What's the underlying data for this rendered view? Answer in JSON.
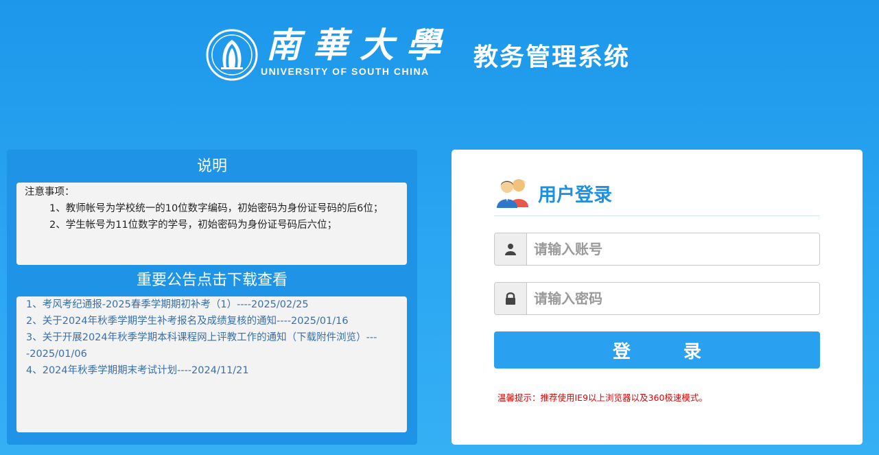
{
  "header": {
    "school_name_cn": "南華大學",
    "school_name_en": "UNIVERSITY OF SOUTH CHINA",
    "system_title": "教务管理系统"
  },
  "instructions": {
    "heading": "说明",
    "lines": [
      "注意事项：",
      "1、教师帐号为学校统一的10位数字编码，初始密码为身份证号码的后6位；",
      "2、学生帐号为11位数字的学号，初始密码为身份证号码后六位；"
    ]
  },
  "notices": {
    "heading": "重要公告点击下载查看",
    "items": [
      "1、考风考纪通报-2025春季学期期初补考（1）----2025/02/25",
      "2、关于2024年秋季学期学生补考报名及成绩复核的通知----2025/01/16",
      "3、关于开展2024年秋季学期本科课程网上评教工作的通知（下载附件浏览）----2025/01/06",
      "4、2024年秋季学期期末考试计划----2024/11/21"
    ]
  },
  "login": {
    "title": "用户登录",
    "user_icon": "user-icon",
    "lock_icon": "lock-icon",
    "username_placeholder": "请输入账号",
    "password_placeholder": "请输入密码",
    "button_label": "登 录",
    "tip": "温馨提示：推荐使用IE9以上浏览器以及360极速模式。"
  },
  "colors": {
    "background": "#2aa6f2",
    "panel_blue": "#1f93e6",
    "login_button": "#2aa0f0",
    "title_blue": "#1f8fe0",
    "tip_red": "#e00000",
    "link": "#3a6fa8"
  }
}
